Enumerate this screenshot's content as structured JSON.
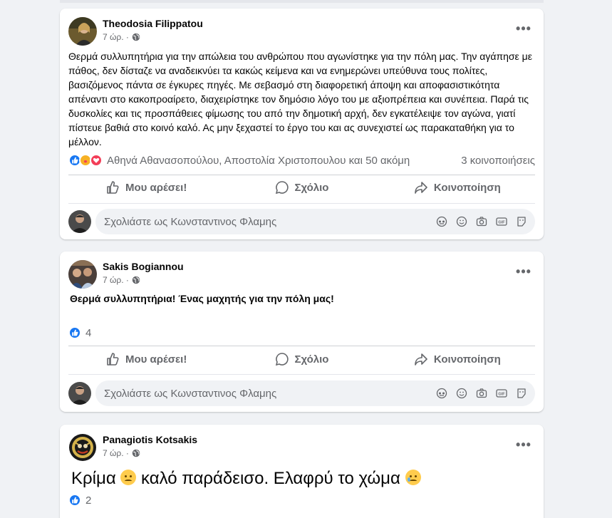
{
  "posts": [
    {
      "author": "Theodosia Filippatou",
      "time": "7 ώρ. ·",
      "text": "Θερμά συλλυπητήρια για την απώλεια του ανθρώπου που αγωνίστηκε για την πόλη μας. Την αγάπησε με πάθος, δεν δίσταζε να αναδεικνύει τα κακώς κείμενα και να ενημερώνει υπεύθυνα τους πολίτες, βασιζόμενος πάντα σε έγκυρες πηγές. Με σεβασμό στη διαφορετική άποψη και αποφασιστικότητα απέναντι στο κακοπροαίρετο, διαχειρίστηκε τον δημόσιο λόγο του με αξιοπρέπεια και συνέπεια. Παρά τις δυσκολίες και τις προσπάθειες φίμωσης του από την δημοτική αρχή, δεν εγκατέλειψε τον αγώνα, γιατί πίστευε βαθιά στο κοινό καλό. Ας μην ξεχαστεί το έργο του και ας συνεχιστεί ως παρακαταθήκη για το μέλλον.",
      "reactions_text": "Αθηνά Αθανασοπούλου, Αποστολία Χριστοπουλου και 50 ακόμη",
      "shares": "3 κοινοποιήσεις"
    },
    {
      "author": "Sakis Bogiannou",
      "time": "7 ώρ. ·",
      "text": "Θερμά συλλυπητήρια! Ένας μαχητής για την πόλη μας!",
      "reactions_count": "4"
    },
    {
      "author": "Panagiotis Kotsakis",
      "time": "7 ώρ. ·",
      "text_part1": "Κρίμα",
      "text_part2": "καλό παράδεισο. Ελαφρύ το χώμα",
      "reactions_count": "2"
    }
  ],
  "actions": {
    "like": "Μου αρέσει!",
    "comment": "Σχόλιο",
    "share": "Κοινοποίηση"
  },
  "comment_placeholder": "Σχολιάστε ως Κωνσταντινος Φλαμης",
  "more_label": "•••",
  "colors": {
    "background": "#f0f2f5",
    "card": "#ffffff",
    "like_blue": "#1877f2",
    "secondary_text": "#65676b"
  },
  "icons": [
    "globe-icon",
    "more-icon",
    "like-icon",
    "comment-icon",
    "share-icon",
    "avatar-sticker-icon",
    "emoji-icon",
    "camera-icon",
    "gif-icon",
    "sticker-icon"
  ]
}
